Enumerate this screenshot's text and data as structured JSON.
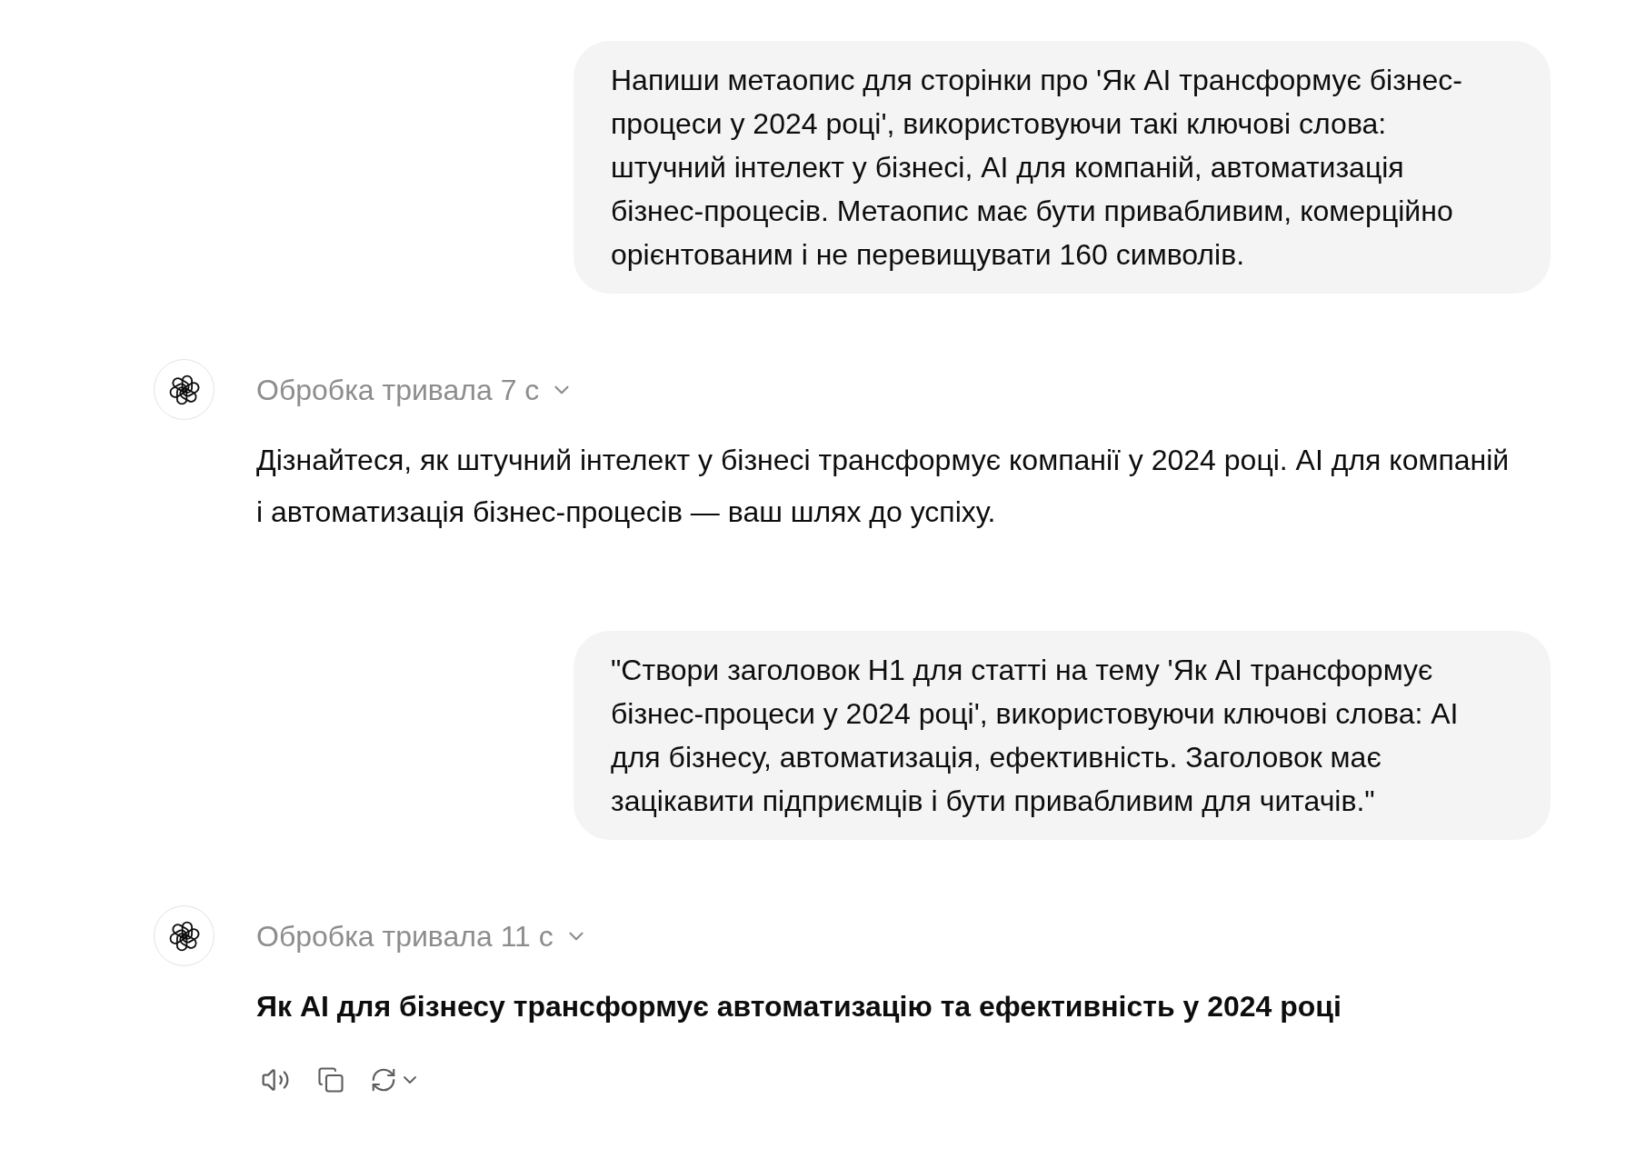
{
  "conversation": [
    {
      "kind": "user",
      "text": "Напиши метаопис для сторінки про 'Як AI трансформує бізнес-процеси у 2024 році', використовуючи такі ключові слова: штучний інтелект у бізнесі, AI для компаній, автоматизація бізнес-процесів. Метаопис має бути привабливим, комерційно орієнтованим і не перевищувати 160 символів."
    },
    {
      "kind": "assistant",
      "thinking": {
        "label": "Обробка тривала 7 с",
        "expanded": false
      },
      "reply": {
        "kind": "plain",
        "text": "Дізнайтеся, як штучний інтелект у бізнесі трансформує компанії у 2024 році. AI для компаній і автоматизація бізнес-процесів — ваш шлях до успіху."
      }
    },
    {
      "kind": "user",
      "text": "\"Створи заголовок H1 для статті на тему 'Як AI трансформує бізнес-процеси у 2024 році', використовуючи ключові слова: AI для бізнесу, автоматизація, ефективність. Заголовок має зацікавити підприємців і бути привабливим для читачів.\""
    },
    {
      "kind": "assistant",
      "thinking": {
        "label": "Обробка тривала 11 с",
        "expanded": false
      },
      "reply": {
        "kind": "bold",
        "text": "Як AI для бізнесу трансформує автоматизацію та ефективність у 2024 році"
      },
      "actions": [
        {
          "kind": "speaker"
        },
        {
          "kind": "copy"
        },
        {
          "kind": "regenerate"
        }
      ]
    }
  ]
}
